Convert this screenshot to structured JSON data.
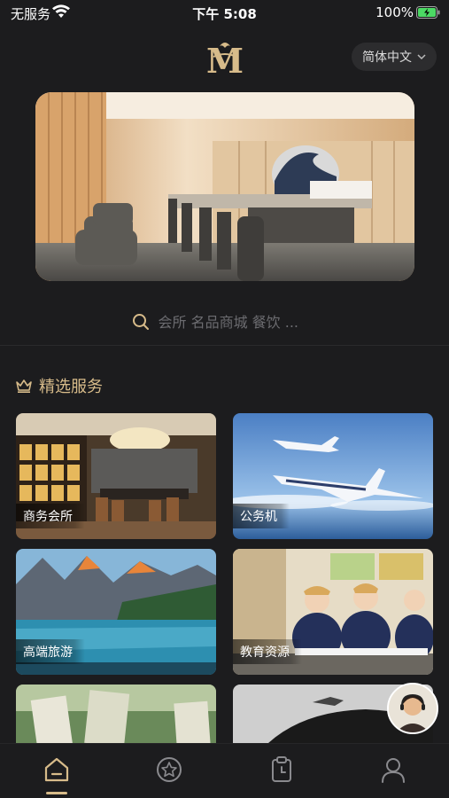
{
  "status_bar": {
    "carrier": "无服务",
    "time": "下午 5:08",
    "battery": "100%"
  },
  "header": {
    "logo_alt": "M",
    "language": "简体中文"
  },
  "search": {
    "placeholder": "会所 名品商城 餐饮 ..."
  },
  "section": {
    "title": "精选服务"
  },
  "services": [
    {
      "label": "商务会所"
    },
    {
      "label": "公务机"
    },
    {
      "label": "高端旅游"
    },
    {
      "label": "教育资源"
    },
    {
      "label": ""
    },
    {
      "label": ""
    }
  ],
  "tabbar": {
    "items": [
      "home-icon",
      "star-icon",
      "clipboard-icon",
      "profile-icon"
    ],
    "active_index": 0
  },
  "colors": {
    "background": "#1c1c1e",
    "accent_gold": "#d7bb8a",
    "muted_text": "#6c6c70"
  }
}
